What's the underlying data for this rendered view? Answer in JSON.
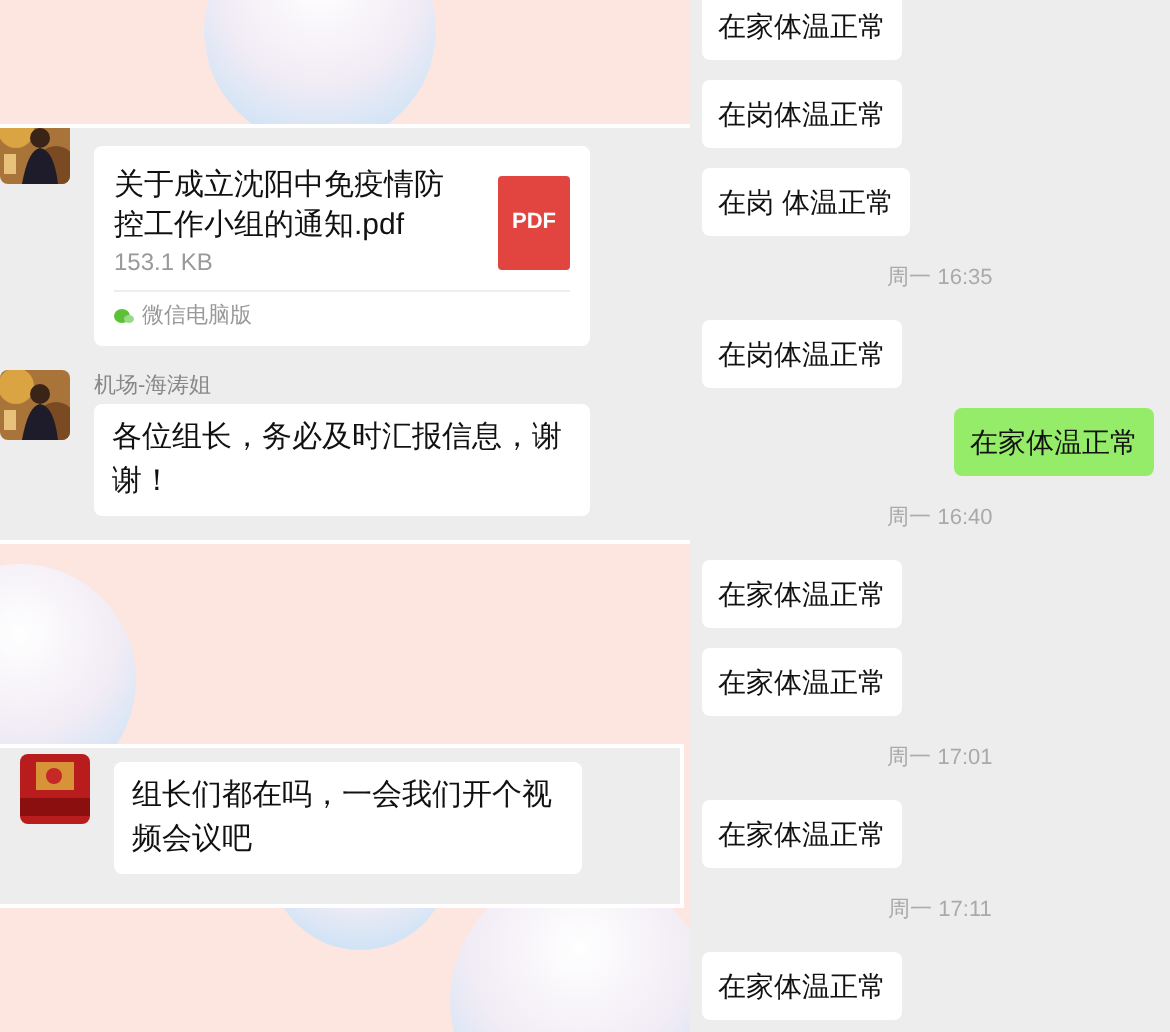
{
  "left_panels": [
    {
      "messages": [
        {
          "kind": "file",
          "file_name": "关于成立沈阳中免疫情防控工作小组的通知.pdf",
          "size": "153.1 KB",
          "file_type": "PDF",
          "source": "微信电脑版"
        },
        {
          "kind": "text",
          "sender": "机场-海涛姐",
          "text": "各位组长，务必及时汇报信息，谢谢！"
        }
      ]
    },
    {
      "messages": [
        {
          "kind": "text",
          "text": "组长们都在吗，一会我们开个视频会议吧"
        }
      ]
    }
  ],
  "right_chat": {
    "items": [
      {
        "kind": "incoming",
        "text": "在家体温正常"
      },
      {
        "kind": "incoming",
        "text": "在岗体温正常"
      },
      {
        "kind": "incoming",
        "text": "在岗 体温正常"
      },
      {
        "kind": "time",
        "text": "周一 16:35"
      },
      {
        "kind": "incoming",
        "text": "在岗体温正常"
      },
      {
        "kind": "outgoing",
        "text": "在家体温正常"
      },
      {
        "kind": "time",
        "text": "周一 16:40"
      },
      {
        "kind": "incoming",
        "text": "在家体温正常"
      },
      {
        "kind": "incoming",
        "text": "在家体温正常"
      },
      {
        "kind": "time",
        "text": "周一 17:01"
      },
      {
        "kind": "incoming",
        "text": "在家体温正常"
      },
      {
        "kind": "time",
        "text": "周一 17:11"
      },
      {
        "kind": "incoming",
        "text": "在家体温正常"
      }
    ]
  }
}
